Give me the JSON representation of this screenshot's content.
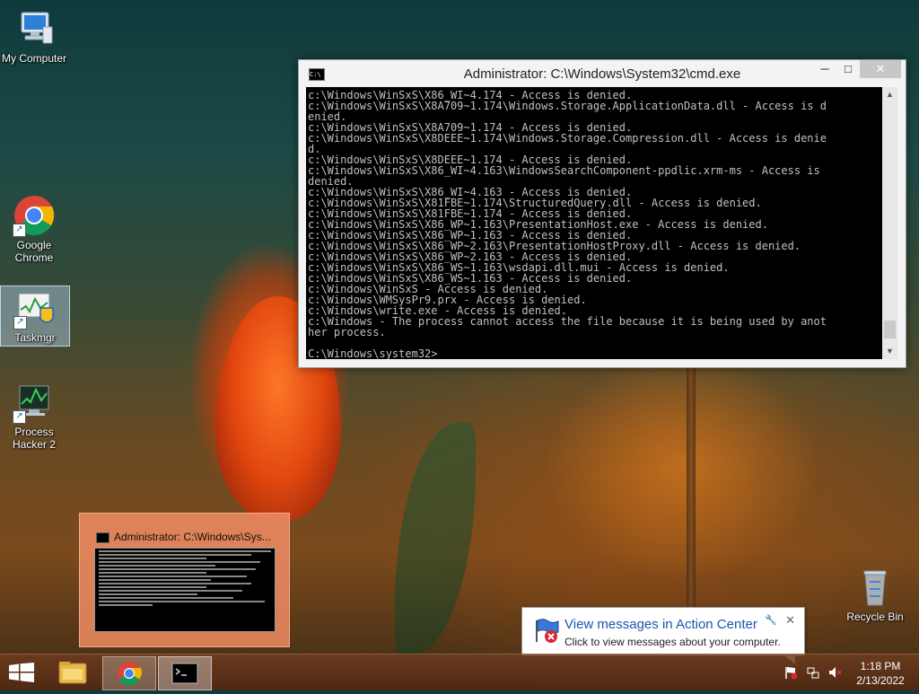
{
  "desktop": {
    "icons": [
      {
        "label": "My Computer"
      },
      {
        "label": "Google Chrome"
      },
      {
        "label": "Taskmgr"
      },
      {
        "label": "Process Hacker 2"
      },
      {
        "label": "Recycle Bin"
      }
    ]
  },
  "cmd_window": {
    "title": "Administrator: C:\\Windows\\System32\\cmd.exe",
    "controls": {
      "minimize": "─",
      "maximize": "□",
      "close": "✕"
    },
    "console_text": "c:\\Windows\\WinSxS\\X86_WI~4.174 - Access is denied.\nc:\\Windows\\WinSxS\\X8A709~1.174\\Windows.Storage.ApplicationData.dll - Access is d\nenied.\nc:\\Windows\\WinSxS\\X8A709~1.174 - Access is denied.\nc:\\Windows\\WinSxS\\X8DEEE~1.174\\Windows.Storage.Compression.dll - Access is denie\nd.\nc:\\Windows\\WinSxS\\X8DEEE~1.174 - Access is denied.\nc:\\Windows\\WinSxS\\X86_WI~4.163\\WindowsSearchComponent-ppdlic.xrm-ms - Access is\ndenied.\nc:\\Windows\\WinSxS\\X86_WI~4.163 - Access is denied.\nc:\\Windows\\WinSxS\\X81FBE~1.174\\StructuredQuery.dll - Access is denied.\nc:\\Windows\\WinSxS\\X81FBE~1.174 - Access is denied.\nc:\\Windows\\WinSxS\\X86_WP~1.163\\PresentationHost.exe - Access is denied.\nc:\\Windows\\WinSxS\\X86_WP~1.163 - Access is denied.\nc:\\Windows\\WinSxS\\X86_WP~2.163\\PresentationHostProxy.dll - Access is denied.\nc:\\Windows\\WinSxS\\X86_WP~2.163 - Access is denied.\nc:\\Windows\\WinSxS\\X86_WS~1.163\\wsdapi.dll.mui - Access is denied.\nc:\\Windows\\WinSxS\\X86_WS~1.163 - Access is denied.\nc:\\Windows\\WinSxS - Access is denied.\nc:\\Windows\\WMSysPr9.prx - Access is denied.\nc:\\Windows\\write.exe - Access is denied.\nc:\\Windows - The process cannot access the file because it is being used by anot\nher process.\n\nC:\\Windows\\system32>"
  },
  "taskbar_preview": {
    "title": "Administrator: C:\\Windows\\Sys..."
  },
  "action_center": {
    "title": "View messages in Action Center",
    "text": "Click to view messages about your computer.",
    "close": "✕",
    "pin": "🔧"
  },
  "taskbar": {
    "time": "1:18 PM",
    "date": "2/13/2022"
  },
  "colors": {
    "console_bg": "#000000",
    "console_fg": "#c0c0c0",
    "link_blue": "#1a56b0"
  }
}
